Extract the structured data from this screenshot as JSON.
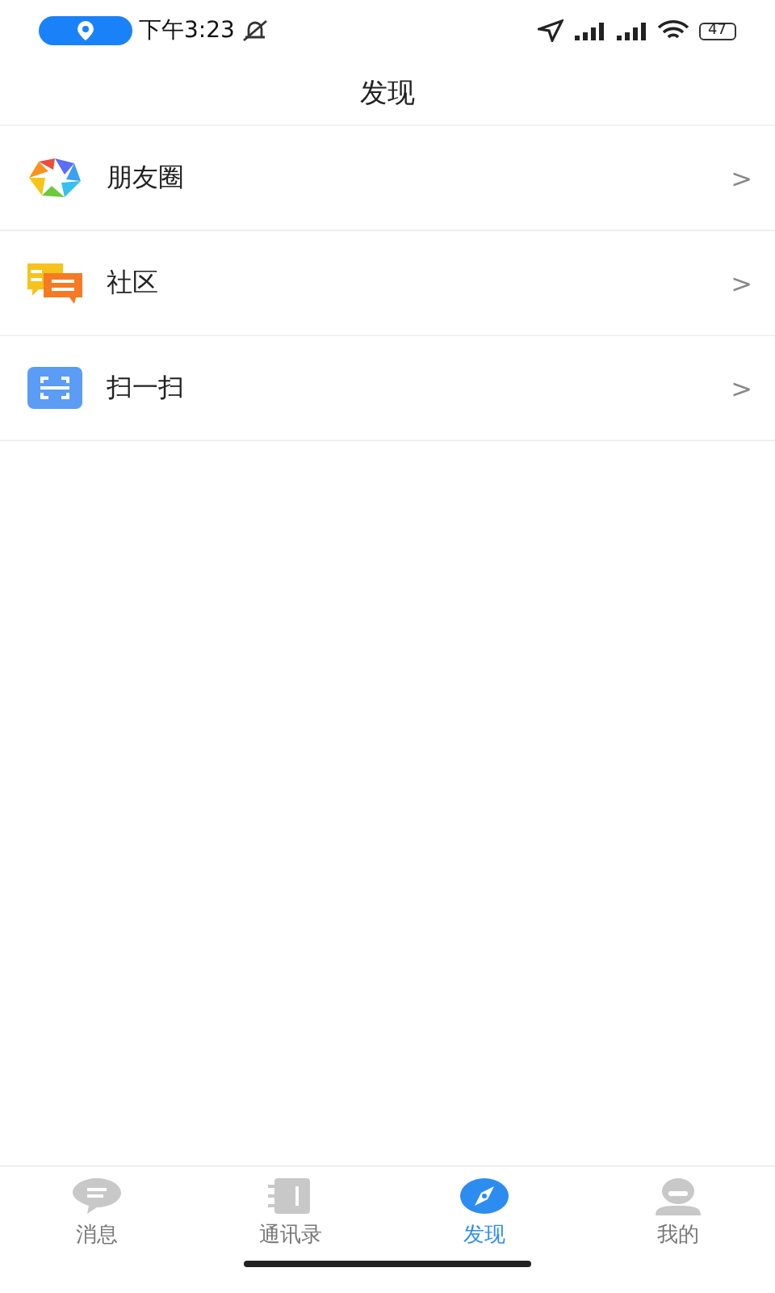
{
  "status_bar": {
    "time": "下午3:23",
    "battery": "47"
  },
  "header": {
    "title": "发现"
  },
  "items": [
    {
      "kind": "moments",
      "label": "朋友圈",
      "chevron": ">"
    },
    {
      "kind": "community",
      "label": "社区",
      "chevron": ">"
    },
    {
      "kind": "scan",
      "label": "扫一扫",
      "chevron": ">"
    }
  ],
  "tabs": [
    {
      "kind": "chat",
      "label": "消息",
      "selected": false
    },
    {
      "kind": "contacts",
      "label": "通讯录",
      "selected": false
    },
    {
      "kind": "discover",
      "label": "发现",
      "selected": true
    },
    {
      "kind": "me",
      "label": "我的",
      "selected": false
    }
  ]
}
